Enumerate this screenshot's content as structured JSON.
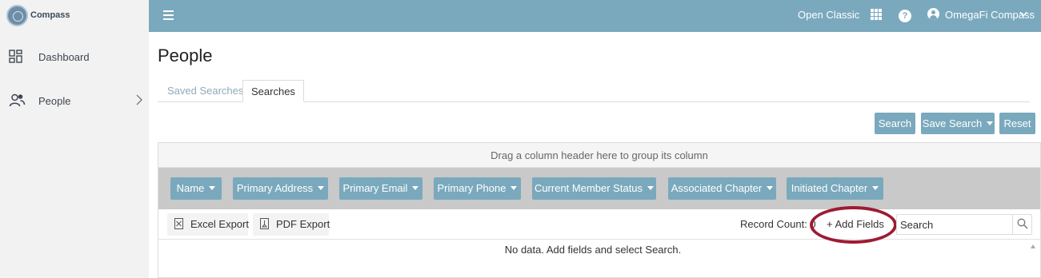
{
  "brand": {
    "name": "Compass"
  },
  "sidebar": {
    "items": [
      {
        "label": "Dashboard",
        "icon": "dashboard-grid-icon"
      },
      {
        "label": "People",
        "icon": "people-icon"
      }
    ]
  },
  "topbar": {
    "open_classic": "Open Classic",
    "help": "?",
    "user": "OmegaFi Compass"
  },
  "page": {
    "title": "People"
  },
  "tabs": {
    "saved": "Saved Searches",
    "searches": "Searches"
  },
  "actions": {
    "search": "Search",
    "save_search": "Save Search",
    "reset": "Reset"
  },
  "grid": {
    "group_hint": "Drag a column header here to group its column",
    "columns": [
      "Name",
      "Primary Address",
      "Primary Email",
      "Primary Phone",
      "Current Member Status",
      "Associated Chapter",
      "Initiated Chapter"
    ],
    "toolbar": {
      "excel_export": "Excel Export",
      "pdf_export": "PDF Export",
      "record_count": "Record Count: 0",
      "add_fields": "+ Add Fields",
      "search_placeholder": "Search"
    },
    "empty_message": "No data. Add fields and select Search."
  },
  "colors": {
    "accent": "#7aa9bd",
    "highlight": "#9e1b32",
    "sidebar_bg": "#f2f2f2"
  }
}
